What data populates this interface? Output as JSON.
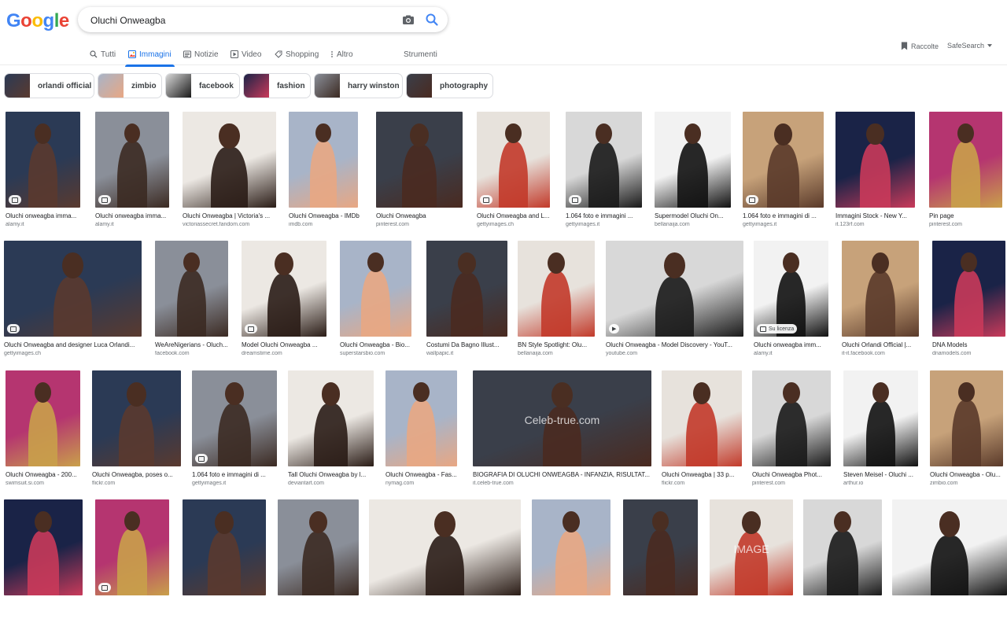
{
  "logo": {
    "letters": [
      "G",
      "o",
      "o",
      "g",
      "l",
      "e"
    ],
    "colors": [
      "#4285F4",
      "#EA4335",
      "#FBBC05",
      "#4285F4",
      "#34A853",
      "#EA4335"
    ]
  },
  "search": {
    "query": "Oluchi Onweagba"
  },
  "icons": {
    "camera": "camera-icon",
    "search": "search-icon"
  },
  "tabs": [
    {
      "label": "Tutti",
      "icon": "search-icon"
    },
    {
      "label": "Immagini",
      "icon": "image-icon",
      "active": true
    },
    {
      "label": "Notizie",
      "icon": "news-icon"
    },
    {
      "label": "Video",
      "icon": "play-icon"
    },
    {
      "label": "Shopping",
      "icon": "tag-icon"
    },
    {
      "label": "Altro",
      "icon": "more-vert-icon"
    }
  ],
  "tools_label": "Strumenti",
  "collections_label": "Raccolte",
  "safesearch_label": "SafeSearch",
  "chips": [
    "orlandi official",
    "zimbio",
    "facebook",
    "fashion",
    "harry winston",
    "photography"
  ],
  "row1": [
    {
      "title": "Oluchi onweagba imma...",
      "source": "alamy.it",
      "badge": true
    },
    {
      "title": "Oluchi onweagba imma...",
      "source": "alamy.it",
      "badge": true
    },
    {
      "title": "Oluchi Onweagba | Victoria's ...",
      "source": "victoriassecret.fandom.com"
    },
    {
      "title": "Oluchi Onweagba - IMDb",
      "source": "imdb.com"
    },
    {
      "title": "Oluchi Onweagba",
      "source": "pinterest.com"
    },
    {
      "title": "Oluchi Onweagba and L...",
      "source": "gettyimages.ch",
      "badge": true
    },
    {
      "title": "1.064 foto e immagini ...",
      "source": "gettyimages.it",
      "badge": true
    },
    {
      "title": "Supermodel Oluchi On...",
      "source": "bellanaija.com"
    },
    {
      "title": "1.064 foto e immagini di ...",
      "source": "gettyimages.it",
      "badge": true
    },
    {
      "title": "Immagini Stock - New Y...",
      "source": "it.123rf.com"
    },
    {
      "title": "Pin page",
      "source": "pinterest.com"
    }
  ],
  "row2": [
    {
      "title": "Oluchi Onweagba and designer Luca Orlandi...",
      "source": "gettyimages.ch",
      "badge": true
    },
    {
      "title": "WeAreNigerians - Oluch...",
      "source": "facebook.com"
    },
    {
      "title": "Model Oluchi Onweagba ...",
      "source": "dreamstime.com",
      "badge": true
    },
    {
      "title": "Oluchi Onweagba - Bio...",
      "source": "superstarsbio.com"
    },
    {
      "title": "Costumi Da Bagno Illust...",
      "source": "wallpapic.it"
    },
    {
      "title": "BN Style Spotlight: Olu...",
      "source": "bellanaija.com"
    },
    {
      "title": "Oluchi Onweagba - Model Discovery - YouT...",
      "source": "youtube.com",
      "play": true
    },
    {
      "title": "Oluchi onweagba imm...",
      "source": "alamy.it",
      "license": "Su licenza"
    },
    {
      "title": "Oluchi Orlandi Official |...",
      "source": "it-it.facebook.com"
    },
    {
      "title": "DNA Models",
      "source": "dnamodels.com"
    }
  ],
  "row3": [
    {
      "title": "Oluchi Onweagba - 200...",
      "source": "swimsuit.si.com"
    },
    {
      "title": "Oluchi Onweagba, poses o...",
      "source": "flickr.com"
    },
    {
      "title": "1.064 foto e immagini di ...",
      "source": "gettyimages.it",
      "badge": true
    },
    {
      "title": "Tall Oluchi Onweagba by l...",
      "source": "deviantart.com"
    },
    {
      "title": "Oluchi Onweagba - Fas...",
      "source": "nymag.com"
    },
    {
      "title": "BIOGRAFIA DI OLUCHI ONWEAGBA - INFANZIA, RISULTAT...",
      "source": "it.celeb-true.com",
      "watermark": "Celeb-true.com"
    },
    {
      "title": "Oluchi Onweagba | 33 p...",
      "source": "flickr.com"
    },
    {
      "title": "Oluchi Onweagba Phot...",
      "source": "pinterest.com"
    },
    {
      "title": "Steven Meisel - Oluchi ...",
      "source": "arthur.io"
    },
    {
      "title": "Oluchi Onweagba - Olu...",
      "source": "zimbio.com"
    }
  ],
  "row4": [
    {
      "title": "",
      "source": ""
    },
    {
      "title": "",
      "source": "",
      "badge": true
    },
    {
      "title": "",
      "source": ""
    },
    {
      "title": "",
      "source": ""
    },
    {
      "title": "",
      "source": ""
    },
    {
      "title": "",
      "source": ""
    },
    {
      "title": "",
      "source": ""
    },
    {
      "title": "",
      "source": "",
      "watermark": "IMAGE"
    },
    {
      "title": "",
      "source": ""
    },
    {
      "title": "",
      "source": ""
    }
  ]
}
